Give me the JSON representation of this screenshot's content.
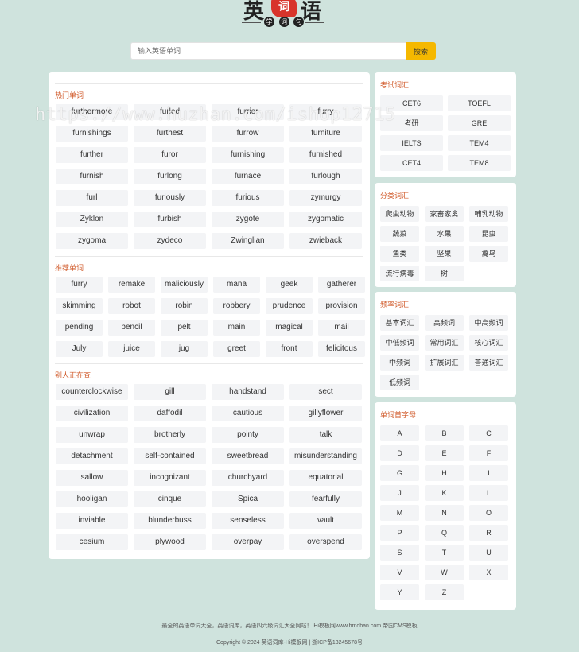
{
  "logo": {
    "char1": "英",
    "char2": "词",
    "char3": "语",
    "sub": [
      "学",
      "词",
      "句"
    ]
  },
  "search": {
    "placeholder": "输入英语单词",
    "button": "搜索"
  },
  "hot": {
    "title": "热门单词",
    "words": [
      "furthermore",
      "furled",
      "furrier",
      "furry",
      "furnishings",
      "furthest",
      "furrow",
      "furniture",
      "further",
      "furor",
      "furnishing",
      "furnished",
      "furnish",
      "furlong",
      "furnace",
      "furlough",
      "furl",
      "furiously",
      "furious",
      "zymurgy",
      "Zyklon",
      "furbish",
      "zygote",
      "zygomatic",
      "zygoma",
      "zydeco",
      "Zwinglian",
      "zwieback"
    ]
  },
  "recommend": {
    "title": "推荐单词",
    "words": [
      "furry",
      "remake",
      "maliciously",
      "mana",
      "geek",
      "gatherer",
      "skimming",
      "robot",
      "robin",
      "robbery",
      "prudence",
      "provision",
      "pending",
      "pencil",
      "pelt",
      "main",
      "magical",
      "mail",
      "July",
      "juice",
      "jug",
      "greet",
      "front",
      "felicitous"
    ]
  },
  "unfinished": {
    "title": "别人正在查",
    "words": [
      "counterclockwise",
      "gill",
      "handstand",
      "sect",
      "civilization",
      "daffodil",
      "cautious",
      "gillyflower",
      "unwrap",
      "brotherly",
      "pointy",
      "talk",
      "detachment",
      "self-contained",
      "sweetbread",
      "misunderstanding",
      "sallow",
      "incognizant",
      "churchyard",
      "equatorial",
      "hooligan",
      "cinque",
      "Spica",
      "fearfully",
      "inviable",
      "blunderbuss",
      "senseless",
      "vault",
      "cesium",
      "plywood",
      "overpay",
      "overspend"
    ]
  },
  "exam": {
    "title": "考试词汇",
    "items": [
      "CET6",
      "TOEFL",
      "考研",
      "GRE",
      "IELTS",
      "TEM4",
      "CET4",
      "TEM8"
    ]
  },
  "category": {
    "title": "分类词汇",
    "items": [
      "爬虫动物",
      "家畜家禽",
      "哺乳动物",
      "蔬菜",
      "水果",
      "昆虫",
      "鱼类",
      "坚果",
      "禽鸟",
      "流行病毒",
      "树"
    ]
  },
  "frequency": {
    "title": "频率词汇",
    "items": [
      "基本词汇",
      "高频词",
      "中高频词",
      "中低频词",
      "常用词汇",
      "核心词汇",
      "中频词",
      "扩展词汇",
      "普通词汇",
      "低频词"
    ]
  },
  "letters": {
    "title": "单词首字母",
    "items": [
      "A",
      "B",
      "C",
      "D",
      "E",
      "F",
      "G",
      "H",
      "I",
      "J",
      "K",
      "L",
      "M",
      "N",
      "O",
      "P",
      "Q",
      "R",
      "S",
      "T",
      "U",
      "V",
      "W",
      "X",
      "Y",
      "Z"
    ]
  },
  "footer": {
    "line1": "最全的英语单词大全，英语词库，英语四六级词汇大全网站！ Hi模板网www.hmoban.com 帝国CMS模板",
    "line2": "Copyright © 2024 英语词库-Hi模板网 | 浙ICP备13245678号"
  },
  "watermark": "https://www.huzhan.com/ishop12715"
}
